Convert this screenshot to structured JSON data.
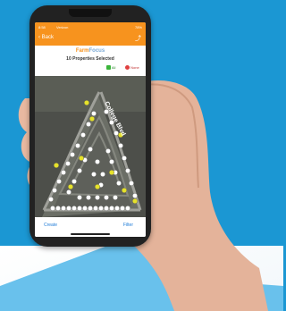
{
  "status": {
    "time": "8:58",
    "network": "Verizon",
    "battery": "78%"
  },
  "nav": {
    "back_label": "Back",
    "share_icon": "share-icon"
  },
  "app": {
    "brand_left": "Farm",
    "brand_right": "Focus",
    "selected_text": "10 Properties Selected"
  },
  "select": {
    "all_label": "All",
    "none_label": "None"
  },
  "map": {
    "street_label": "College Blvd"
  },
  "bottom": {
    "create_label": "Create",
    "filter_label": "Filter"
  },
  "colors": {
    "accent": "#f7931e",
    "link": "#1e7bd7",
    "background": "#1b97d3"
  }
}
